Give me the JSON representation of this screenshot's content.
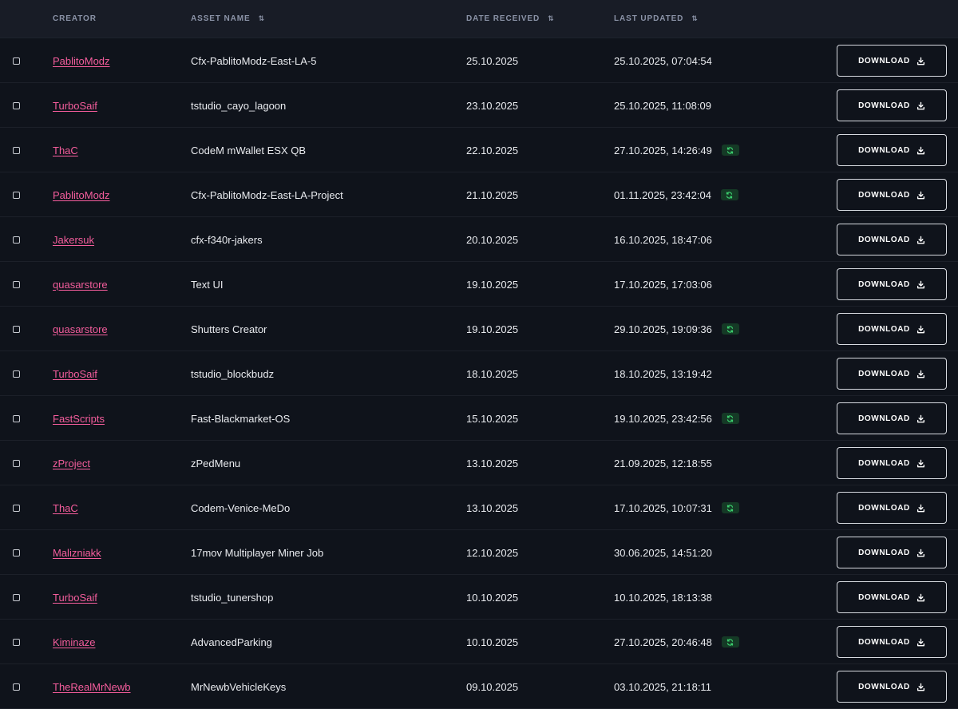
{
  "columns": {
    "creator": "CREATOR",
    "asset": "ASSET NAME",
    "date_received": "DATE RECEIVED",
    "last_updated": "LAST UPDATED",
    "sort_glyph": "⇅"
  },
  "download_label": "DOWNLOAD",
  "colors": {
    "link": "#f45d9c",
    "badge_bg": "#153a26",
    "badge_icon": "#3ccf6e"
  },
  "rows": [
    {
      "creator": "PablitoModz",
      "asset": "Cfx-PablitoModz-East-LA-5",
      "received": "25.10.2025",
      "updated": "25.10.2025, 07:04:54",
      "update_badge": false
    },
    {
      "creator": "TurboSaif",
      "asset": "tstudio_cayo_lagoon",
      "received": "23.10.2025",
      "updated": "25.10.2025, 11:08:09",
      "update_badge": false
    },
    {
      "creator": "ThaC",
      "asset": "CodeM mWallet ESX QB",
      "received": "22.10.2025",
      "updated": "27.10.2025, 14:26:49",
      "update_badge": true
    },
    {
      "creator": "PablitoModz",
      "asset": "Cfx-PablitoModz-East-LA-Project",
      "received": "21.10.2025",
      "updated": "01.11.2025, 23:42:04",
      "update_badge": true
    },
    {
      "creator": "Jakersuk",
      "asset": "cfx-f340r-jakers",
      "received": "20.10.2025",
      "updated": "16.10.2025, 18:47:06",
      "update_badge": false
    },
    {
      "creator": "quasarstore",
      "asset": "Text UI",
      "received": "19.10.2025",
      "updated": "17.10.2025, 17:03:06",
      "update_badge": false
    },
    {
      "creator": "quasarstore",
      "asset": "Shutters Creator",
      "received": "19.10.2025",
      "updated": "29.10.2025, 19:09:36",
      "update_badge": true
    },
    {
      "creator": "TurboSaif",
      "asset": "tstudio_blockbudz",
      "received": "18.10.2025",
      "updated": "18.10.2025, 13:19:42",
      "update_badge": false
    },
    {
      "creator": "FastScripts",
      "asset": "Fast-Blackmarket-OS",
      "received": "15.10.2025",
      "updated": "19.10.2025, 23:42:56",
      "update_badge": true
    },
    {
      "creator": "zProject",
      "asset": "zPedMenu",
      "received": "13.10.2025",
      "updated": "21.09.2025, 12:18:55",
      "update_badge": false
    },
    {
      "creator": "ThaC",
      "asset": "Codem-Venice-MeDo",
      "received": "13.10.2025",
      "updated": "17.10.2025, 10:07:31",
      "update_badge": true
    },
    {
      "creator": "Malizniakk",
      "asset": "17mov Multiplayer Miner Job",
      "received": "12.10.2025",
      "updated": "30.06.2025, 14:51:20",
      "update_badge": false
    },
    {
      "creator": "TurboSaif",
      "asset": "tstudio_tunershop",
      "received": "10.10.2025",
      "updated": "10.10.2025, 18:13:38",
      "update_badge": false
    },
    {
      "creator": "Kiminaze",
      "asset": "AdvancedParking",
      "received": "10.10.2025",
      "updated": "27.10.2025, 20:46:48",
      "update_badge": true
    },
    {
      "creator": "TheRealMrNewb",
      "asset": "MrNewbVehicleKeys",
      "received": "09.10.2025",
      "updated": "03.10.2025, 21:18:11",
      "update_badge": false
    }
  ]
}
